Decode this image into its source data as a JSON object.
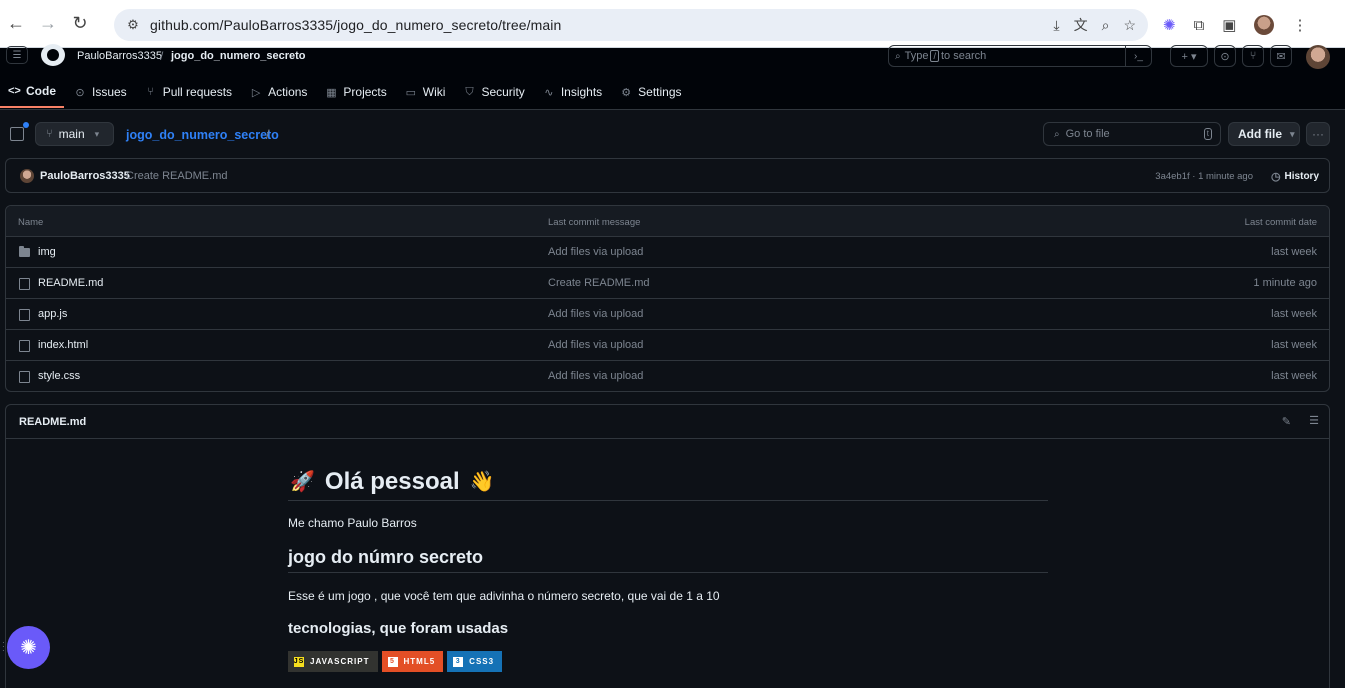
{
  "browser": {
    "url": "github.com/PauloBarros3335/jogo_do_numero_secreto/tree/main",
    "back_icon": "←",
    "forward_icon": "→",
    "reload_icon": "↻",
    "site_info_icon": "⚙",
    "install_icon": "⤓",
    "translate_icon": "文",
    "zoom_icon": "⌕",
    "bookmark_icon": "☆",
    "extension1_icon": "✺",
    "extensions_icon": "⧉",
    "sidepanel_icon": "▣",
    "menu_icon": "⋮"
  },
  "header": {
    "owner": "PauloBarros3335",
    "separator": "/",
    "repo": "jogo_do_numero_secreto",
    "search_prefix": "Type",
    "search_key": "/",
    "search_suffix": "to search",
    "search_icon": "⌕",
    "command_icon": "›_",
    "plus_label": "+ ▾",
    "issues_icon": "⊙",
    "pr_icon": "⑂",
    "inbox_icon": "✉",
    "hamburger_icon": "☰"
  },
  "tabs": [
    {
      "label": "Code",
      "icon": "<>"
    },
    {
      "label": "Issues",
      "icon": "⊙"
    },
    {
      "label": "Pull requests",
      "icon": "⑂"
    },
    {
      "label": "Actions",
      "icon": "▷"
    },
    {
      "label": "Projects",
      "icon": "▦"
    },
    {
      "label": "Wiki",
      "icon": "▭"
    },
    {
      "label": "Security",
      "icon": "⛉"
    },
    {
      "label": "Insights",
      "icon": "∿"
    },
    {
      "label": "Settings",
      "icon": "⚙"
    }
  ],
  "branch": {
    "name": "main",
    "icon": "⑂",
    "caret": "▾",
    "path_repo": "jogo_do_numero_secreto",
    "path_slash": "/",
    "goto_placeholder": "Go to file",
    "goto_key": "t",
    "goto_icon": "⌕",
    "add_file_label": "Add file",
    "more_label": "···"
  },
  "commit": {
    "author": "PauloBarros3335",
    "message": "Create README.md",
    "meta": "3a4eb1f · 1 minute ago",
    "history_label": "History",
    "history_icon": "◷"
  },
  "files": {
    "headers": {
      "name": "Name",
      "message": "Last commit message",
      "date": "Last commit date"
    },
    "rows": [
      {
        "name": "img",
        "type": "folder",
        "message": "Add files via upload",
        "date": "last week"
      },
      {
        "name": "README.md",
        "type": "file",
        "message": "Create README.md",
        "date": "1 minute ago"
      },
      {
        "name": "app.js",
        "type": "file",
        "message": "Add files via upload",
        "date": "last week"
      },
      {
        "name": "index.html",
        "type": "file",
        "message": "Add files via upload",
        "date": "last week"
      },
      {
        "name": "style.css",
        "type": "file",
        "message": "Add files via upload",
        "date": "last week"
      }
    ]
  },
  "readme": {
    "title": "README.md",
    "edit_icon": "✎",
    "toc_icon": "☰",
    "h1": "Olá pessoal",
    "h1_emoji_left": "🚀",
    "h1_emoji_right": "👋",
    "intro": "Me chamo Paulo Barros",
    "h2": "jogo do númro secreto",
    "desc": "Esse é um jogo , que você tem que adivinha o número secreto, que vai de 1 a 10",
    "h3": "tecnologias, que foram usadas",
    "badges": [
      {
        "label": "JAVASCRIPT",
        "icon": "JS",
        "bg": "#323330",
        "icon_bg": "#f7df1e",
        "icon_color": "#000000"
      },
      {
        "label": "HTML5",
        "icon": "5",
        "bg": "#e34f26",
        "icon_bg": "#ffffff",
        "icon_color": "#e34f26"
      },
      {
        "label": "CSS3",
        "icon": "3",
        "bg": "#1572b6",
        "icon_bg": "#ffffff",
        "icon_color": "#1572b6"
      }
    ]
  },
  "floating_button_icon": "✺",
  "colors": {
    "bg": "#0d1117",
    "header_bg": "#010409",
    "border": "#30363d",
    "link": "#2f81f7",
    "muted": "#7d8590",
    "accent_tab": "#f78166"
  }
}
